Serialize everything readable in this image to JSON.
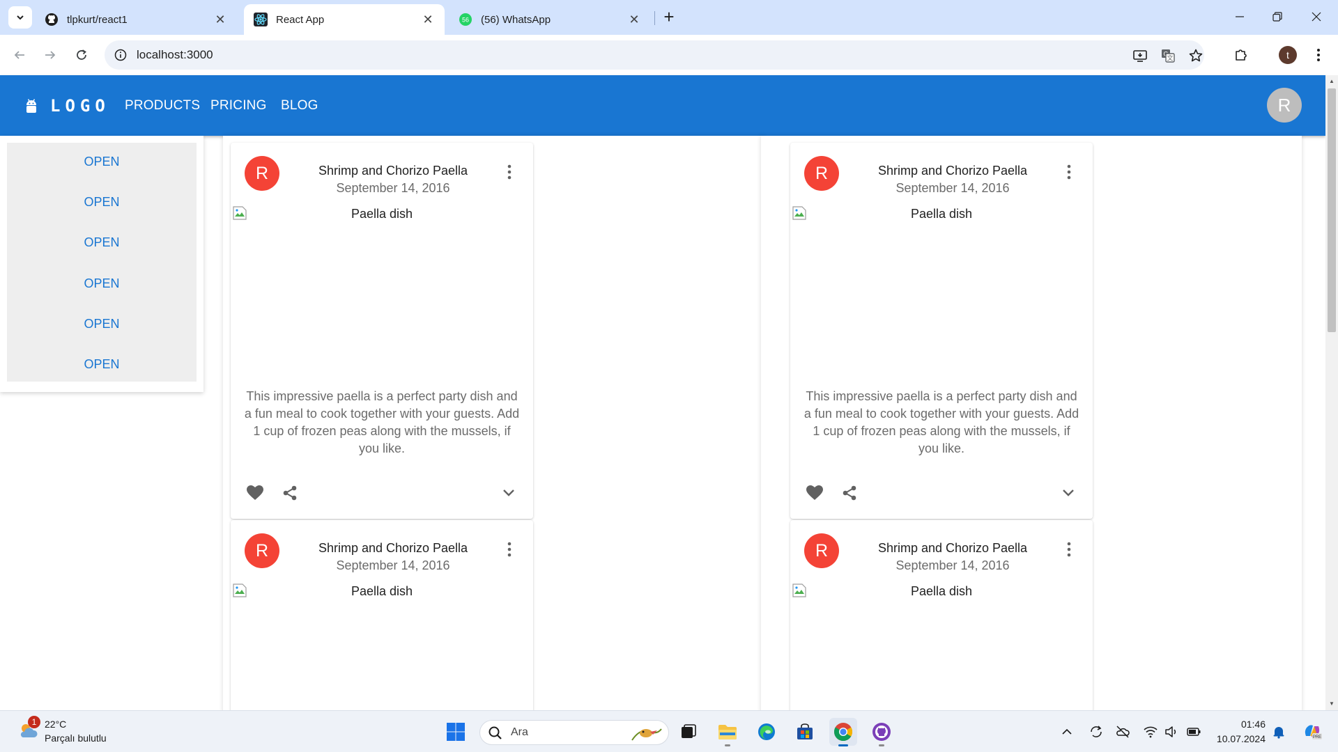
{
  "browser": {
    "tabs": [
      {
        "title": "tlpkurt/react1",
        "icon": "github-icon"
      },
      {
        "title": "React App",
        "icon": "react-icon"
      },
      {
        "title": "(56) WhatsApp",
        "icon": "whatsapp-icon",
        "badge": "56"
      }
    ],
    "url": "localhost:3000",
    "profile_initial": "t"
  },
  "appbar": {
    "logo_text": "LOGO",
    "nav": [
      "PRODUCTS",
      "PRICING",
      "BLOG"
    ],
    "avatar_initial": "R",
    "color": "#1976d2"
  },
  "sidebar": {
    "buttons": [
      "OPEN",
      "OPEN",
      "OPEN",
      "OPEN",
      "OPEN",
      "OPEN"
    ]
  },
  "cards": [
    {
      "avatar": "R",
      "title": "Shrimp and Chorizo Paella",
      "date": "September 14, 2016",
      "image_alt": "Paella dish",
      "body": "This impressive paella is a perfect party dish and a fun meal to cook together with your guests. Add 1 cup of frozen peas along with the mussels, if you like."
    },
    {
      "avatar": "R",
      "title": "Shrimp and Chorizo Paella",
      "date": "September 14, 2016",
      "image_alt": "Paella dish"
    },
    {
      "avatar": "R",
      "title": "Shrimp and Chorizo Paella",
      "date": "September 14, 2016",
      "image_alt": "Paella dish",
      "body": "This impressive paella is a perfect party dish and a fun meal to cook together with your guests. Add 1 cup of frozen peas along with the mussels, if you like."
    },
    {
      "avatar": "R",
      "title": "Shrimp and Chorizo Paella",
      "date": "September 14, 2016",
      "image_alt": "Paella dish"
    }
  ],
  "taskbar": {
    "weather": {
      "temp": "22°C",
      "desc": "Parçalı bulutlu",
      "badge": "1"
    },
    "search_placeholder": "Ara",
    "clock": {
      "time": "01:46",
      "date": "10.07.2024"
    }
  },
  "colors": {
    "accent": "#1976d2",
    "card_avatar": "#f44336",
    "tabstrip": "#d3e3fd"
  }
}
